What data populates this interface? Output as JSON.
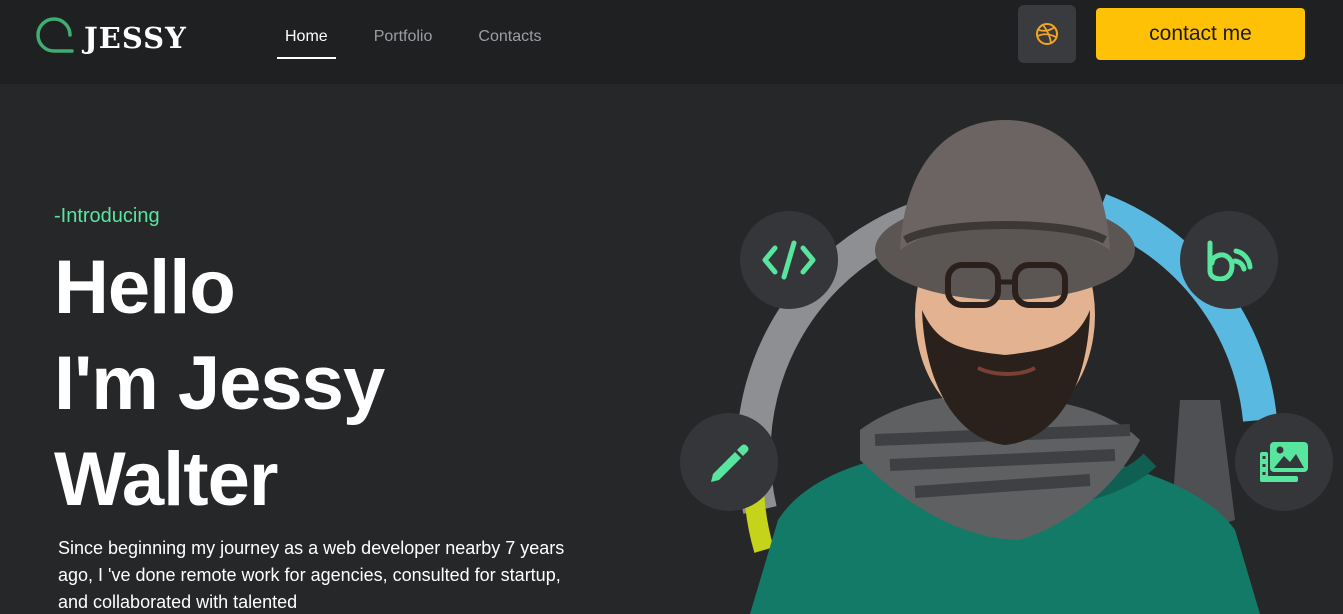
{
  "brand": {
    "name": "JESSY"
  },
  "nav": {
    "items": [
      {
        "label": "Home",
        "active": true
      },
      {
        "label": "Portfolio",
        "active": false
      },
      {
        "label": "Contacts",
        "active": false
      }
    ]
  },
  "header": {
    "social_icon": "dribbble-icon",
    "cta_label": "contact me"
  },
  "hero": {
    "intro": "-Introducing",
    "title_lines": [
      "Hello",
      "I'm Jessy",
      "Walter"
    ],
    "description": "Since beginning my journey as a web developer nearby 7 years ago, I 've done remote work for agencies, consulted for startup, and collaborated with talented"
  },
  "skills": [
    {
      "icon": "code-icon"
    },
    {
      "icon": "behance-icon"
    },
    {
      "icon": "pencil-icon"
    },
    {
      "icon": "images-icon"
    }
  ],
  "colors": {
    "background": "#262729",
    "header": "#1f2022",
    "accent_green": "#58e59e",
    "cta_yellow": "#ffc106",
    "ring_blue": "#5ab9e0",
    "ring_gray": "#8e8f92"
  }
}
